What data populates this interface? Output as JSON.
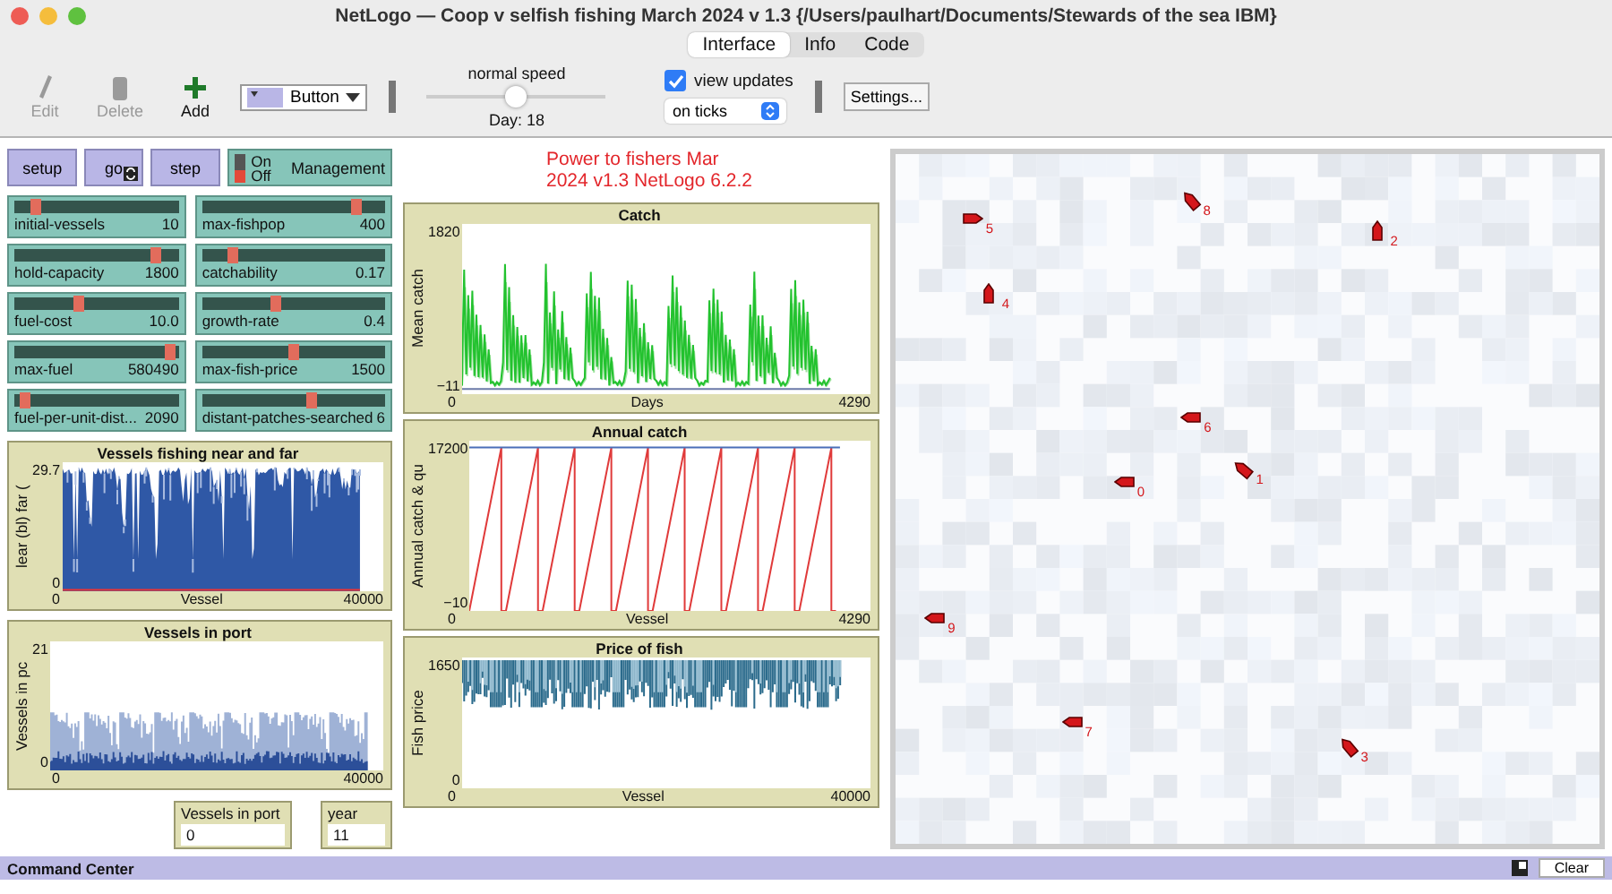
{
  "window": {
    "title": "NetLogo — Coop v selfish fishing March 2024 v 1.3 {/Users/paulhart/Documents/Stewards of the sea IBM}"
  },
  "tabs": [
    {
      "label": "Interface",
      "selected": true
    },
    {
      "label": "Info",
      "selected": false
    },
    {
      "label": "Code",
      "selected": false
    }
  ],
  "toolbar": {
    "tools": [
      {
        "kind": "edit",
        "label": "Edit",
        "disabled": true
      },
      {
        "kind": "delete",
        "label": "Delete",
        "disabled": true
      },
      {
        "kind": "add",
        "label": "Add",
        "disabled": false
      }
    ],
    "widget_type": "Button",
    "speed": {
      "label": "normal speed",
      "level": 0.5,
      "tick": "Day: 18"
    },
    "view_updates": {
      "label": "view updates",
      "checked": true
    },
    "update_mode": "on ticks",
    "settings": "Settings..."
  },
  "buttons": [
    {
      "label": "setup",
      "forever": false
    },
    {
      "label": "go",
      "forever": true
    },
    {
      "label": "step",
      "forever": false
    }
  ],
  "switch": {
    "label": "Management",
    "on_label": "On",
    "off_label": "Off",
    "on": false
  },
  "sliders": [
    {
      "name": "initial-vessels",
      "value": "10",
      "level": 0.1
    },
    {
      "name": "max-fishpop",
      "value": "400",
      "level": 0.86
    },
    {
      "name": "hold-capacity",
      "value": "1800",
      "level": 0.88
    },
    {
      "name": "catchability",
      "value": "0.17",
      "level": 0.15
    },
    {
      "name": "fuel-cost",
      "value": "10.0",
      "level": 0.38
    },
    {
      "name": "growth-rate",
      "value": "0.4",
      "level": 0.4
    },
    {
      "name": "max-fuel",
      "value": "580490",
      "level": 0.98
    },
    {
      "name": "max-fish-price",
      "value": "1500",
      "level": 0.5
    },
    {
      "name": "fuel-per-unit-dist...",
      "value": "2090",
      "level": 0.04
    },
    {
      "name": "distant-patches-searched",
      "value": "6",
      "level": 0.6
    }
  ],
  "note": "Power to fishers Mar 2024 v1.3 NetLogo 6.2.2",
  "plots": [
    {
      "kind": "bars",
      "title": "Vessels fishing near and far",
      "ylabel": "lear (bl) far (",
      "ymax": "29.7",
      "ymin": "0",
      "xmin": "0",
      "xmax": "40000",
      "xlabel": "Vessel"
    },
    {
      "kind": "port",
      "title": "Vessels in port",
      "ylabel": "Vessels in pc",
      "ymax": "21",
      "ymin": "0",
      "xmin": "0",
      "xmax": "40000"
    },
    {
      "kind": "catch",
      "title": "Catch",
      "ylabel": "Mean catch",
      "ymax": "1820",
      "ymin": "−11",
      "xmin": "0",
      "xmax": "4290",
      "xlabel": "Days"
    },
    {
      "kind": "sawtooth",
      "title": "Annual catch",
      "ylabel": "Annual catch & qu",
      "ymax": "17200",
      "ymin": "−10",
      "xmin": "0",
      "xmax": "4290",
      "xlabel": "Vessel"
    },
    {
      "kind": "price",
      "title": "Price of fish",
      "ylabel": "Fish price",
      "ymax": "1650",
      "ymin": "0",
      "xmin": "0",
      "xmax": "40000",
      "xlabel": "Vessel"
    }
  ],
  "monitors": [
    {
      "label": "Vessels in port",
      "value": "0"
    },
    {
      "label": "year",
      "value": "11"
    }
  ],
  "vessels": [
    {
      "label": "5"
    },
    {
      "label": "8"
    },
    {
      "label": "2"
    },
    {
      "label": "4"
    },
    {
      "label": "6"
    },
    {
      "label": "0"
    },
    {
      "label": "1"
    },
    {
      "label": "9"
    },
    {
      "label": "7"
    },
    {
      "label": "3"
    }
  ],
  "command_center": {
    "title": "Command Center",
    "clear": "Clear"
  }
}
